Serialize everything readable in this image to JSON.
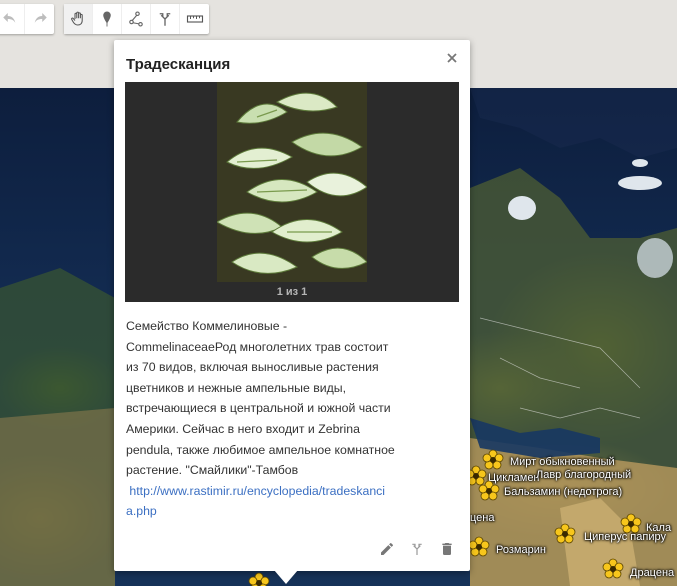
{
  "toolbar": {
    "buttons": [
      {
        "name": "undo",
        "icon": "undo-icon"
      },
      {
        "name": "redo",
        "icon": "redo-icon"
      },
      {
        "name": "pan",
        "icon": "hand-icon"
      },
      {
        "name": "marker",
        "icon": "marker-icon"
      },
      {
        "name": "line",
        "icon": "line-icon"
      },
      {
        "name": "directions",
        "icon": "directions-icon"
      },
      {
        "name": "measure",
        "icon": "ruler-icon"
      }
    ]
  },
  "infowindow": {
    "title": "Традесканция",
    "photo_counter": "1 из 1",
    "description_lines": [
      "Семейство Коммелиновые -",
      "CommelinaceaeРод многолетних трав состоит",
      "из 70 видов, включая выносливые растения",
      "цветников и нежные ампельные виды,",
      "встречающиеся в центральной и южной части",
      "Америки. Сейчас в него входит и Zebrina",
      "pendula, также любимое ампельное комнатное",
      "растение. \"Смайлики\"-Тамбов"
    ],
    "link_part1": "http://www.rastimir.ru/encyclopedia/tradeskanci",
    "link_part2": "a.php",
    "actions": [
      "edit-icon",
      "directions-icon",
      "delete-icon"
    ]
  },
  "map_labels": {
    "mirt": "Мирт обыкновенный",
    "tsiklamen": "Цикламен",
    "lavr": "Лавр благородный",
    "balzamin": "Бальзамин (недотрога)",
    "tsena": "цена",
    "kala": "Кала",
    "tsiperus": "Циперус папиру",
    "rozmarin": "Розмарин",
    "dratsena": "Драцена"
  },
  "colors": {
    "marker_fill": "#f7c61c",
    "marker_stroke": "#5a4400",
    "link": "#3b6fc2"
  }
}
